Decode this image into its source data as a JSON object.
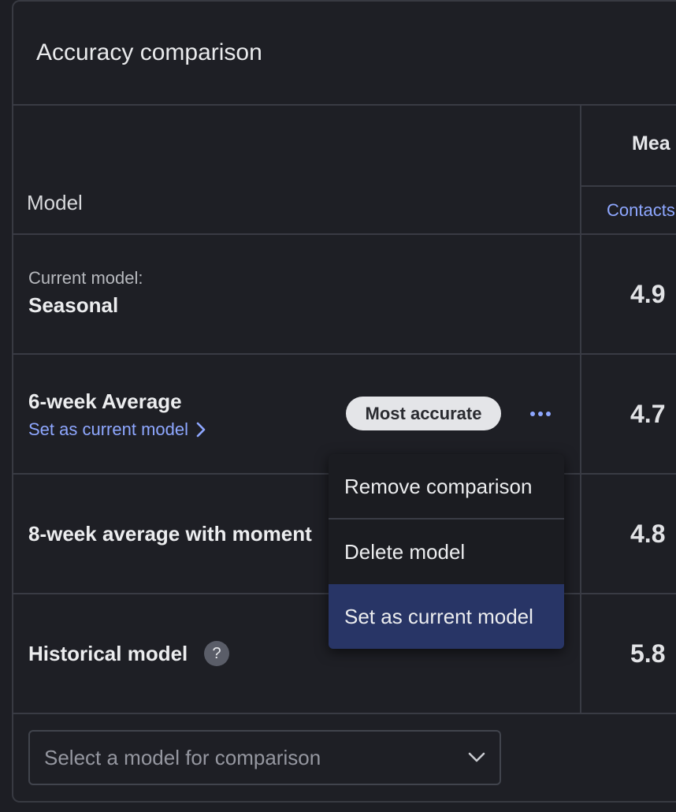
{
  "panel": {
    "title": "Accuracy comparison"
  },
  "table": {
    "model_header": "Model",
    "metric_header": "Mea",
    "metric_subheader": "Contacts",
    "rows": [
      {
        "label": "Current model:",
        "name": "Seasonal",
        "value": "4.9"
      },
      {
        "name": "6-week Average",
        "link": "Set as current model",
        "badge": "Most accurate",
        "value": "4.7"
      },
      {
        "name": "8-week average with moment",
        "value": "4.8"
      },
      {
        "name": "Historical model",
        "help": "?",
        "value": "5.8"
      }
    ]
  },
  "menu": {
    "items": [
      "Remove comparison",
      "Delete model",
      "Set as current model"
    ],
    "active_index": 2
  },
  "compare_select": {
    "placeholder": "Select a model for comparison"
  },
  "colors": {
    "background": "#1d1e24",
    "link": "#8ea7ff",
    "menu_active": "#283566",
    "badge": "#e4e5e8"
  }
}
